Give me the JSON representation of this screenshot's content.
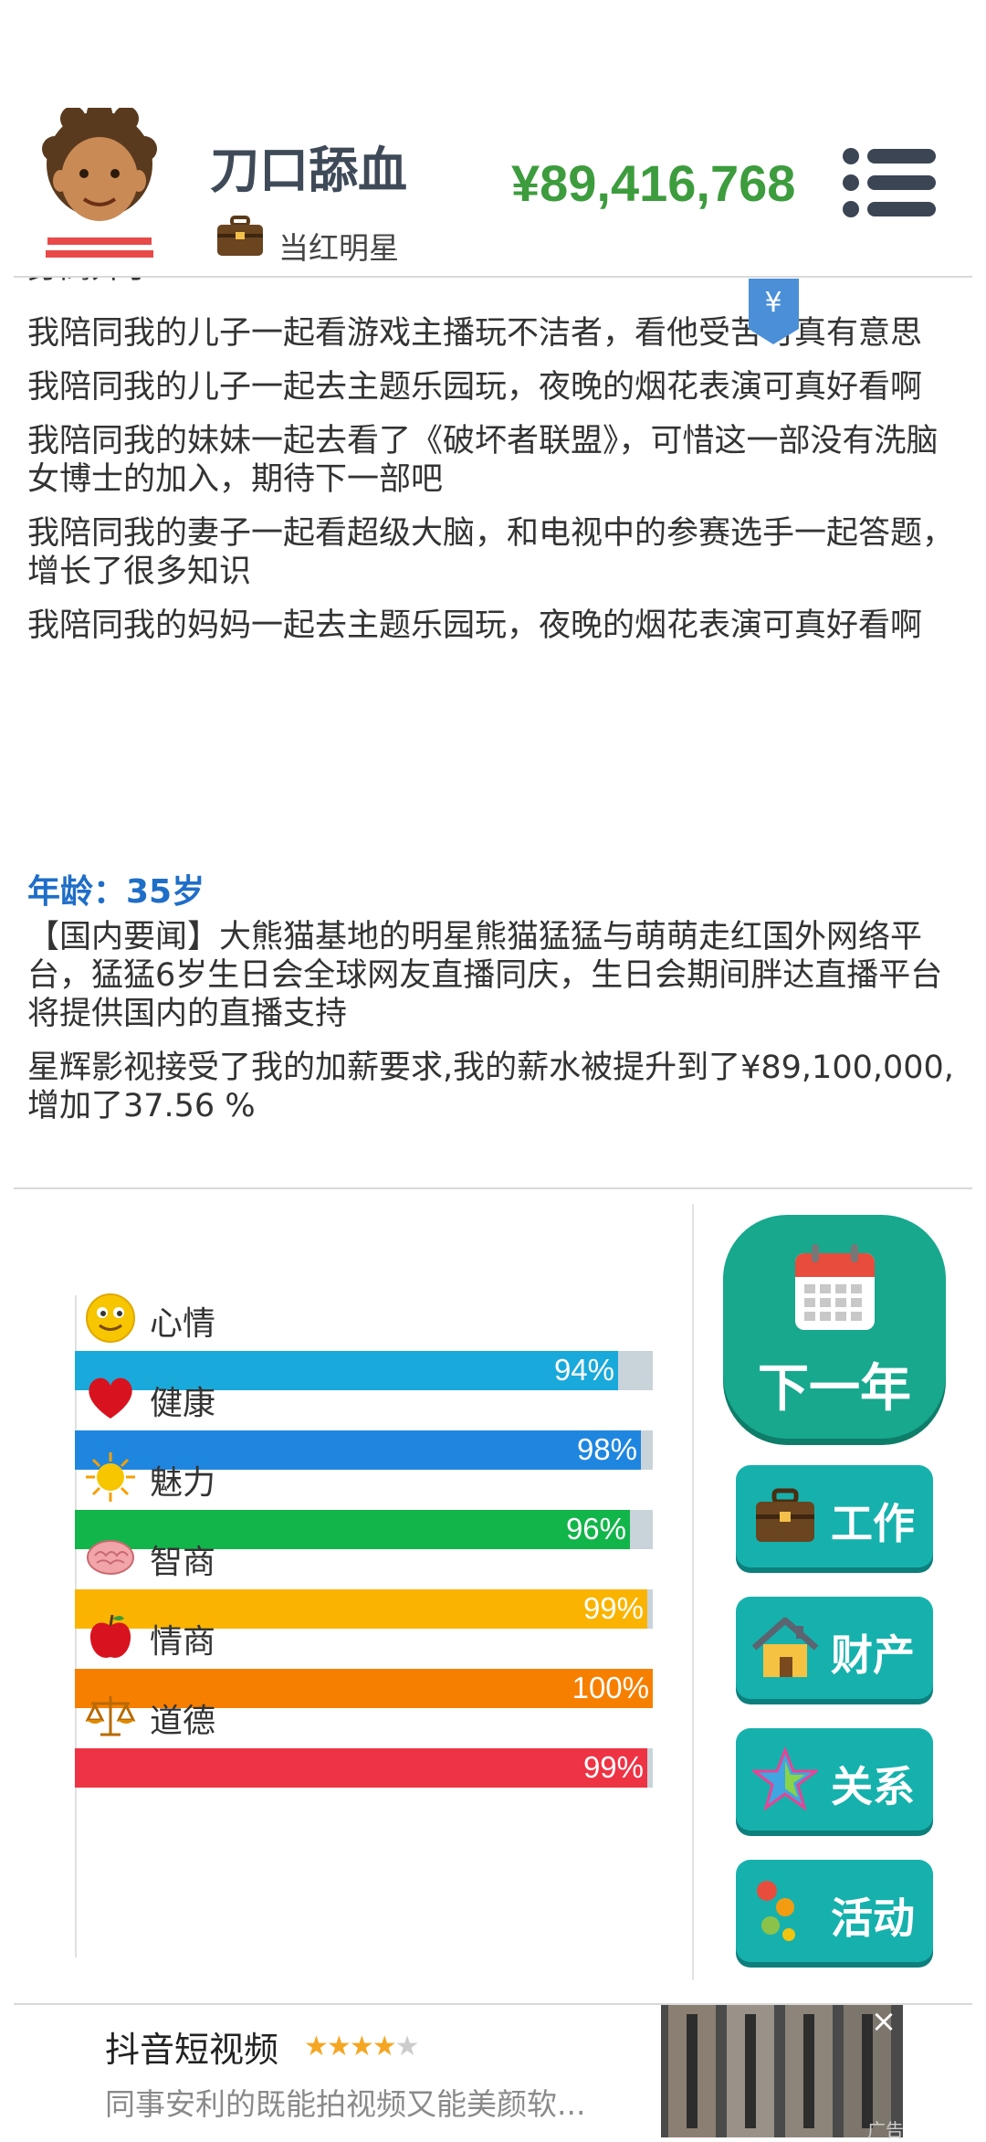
{
  "header": {
    "player_name": "刀口舔血",
    "job_title": "当红明星",
    "money": "¥89,416,768"
  },
  "log": {
    "cut_text": "身高升了",
    "badge": "¥",
    "items": [
      "我陪同我的儿子一起看游戏主播玩不洁者，看他受苦可真有意思",
      "我陪同我的儿子一起去主题乐园玩，夜晚的烟花表演可真好看啊",
      "我陪同我的妹妹一起去看了《破坏者联盟》，可惜这一部没有洗脑女博士的加入，期待下一部吧",
      "我陪同我的妻子一起看超级大脑，和电视中的参赛选手一起答题，增长了很多知识",
      "我陪同我的妈妈一起去主题乐园玩，夜晚的烟花表演可真好看啊"
    ]
  },
  "age_line": "年龄：35岁",
  "news": [
    "【国内要闻】大熊猫基地的明星熊猫猛猛与萌萌走红国外网络平台，猛猛6岁生日会全球网友直播同庆，生日会期间胖达直播平台将提供国内的直播支持",
    "星辉影视接受了我的加薪要求,我的薪水被提升到了¥89,100,000,增加了37.56 %"
  ],
  "stats": [
    {
      "label": "心情",
      "percent": 94,
      "percent_text": "94%",
      "color": "#1aa9db",
      "icon": "smiley-icon"
    },
    {
      "label": "健康",
      "percent": 98,
      "percent_text": "98%",
      "color": "#1f86e0",
      "icon": "heart-icon"
    },
    {
      "label": "魅力",
      "percent": 96,
      "percent_text": "96%",
      "color": "#12b54a",
      "icon": "sun-icon"
    },
    {
      "label": "智商",
      "percent": 99,
      "percent_text": "99%",
      "color": "#fab400",
      "icon": "brain-icon"
    },
    {
      "label": "情商",
      "percent": 100,
      "percent_text": "100%",
      "color": "#f77f00",
      "icon": "apple-icon"
    },
    {
      "label": "道德",
      "percent": 99,
      "percent_text": "99%",
      "color": "#ee3344",
      "icon": "scales-icon"
    }
  ],
  "buttons": {
    "next_year": "下一年",
    "work": "工作",
    "property": "财产",
    "relations": "关系",
    "activity": "活动"
  },
  "ad": {
    "title": "抖音短视频",
    "rating": 4,
    "description": "同事安利的既能拍视频又能美颜软...",
    "close": "×",
    "tag": "广告"
  }
}
